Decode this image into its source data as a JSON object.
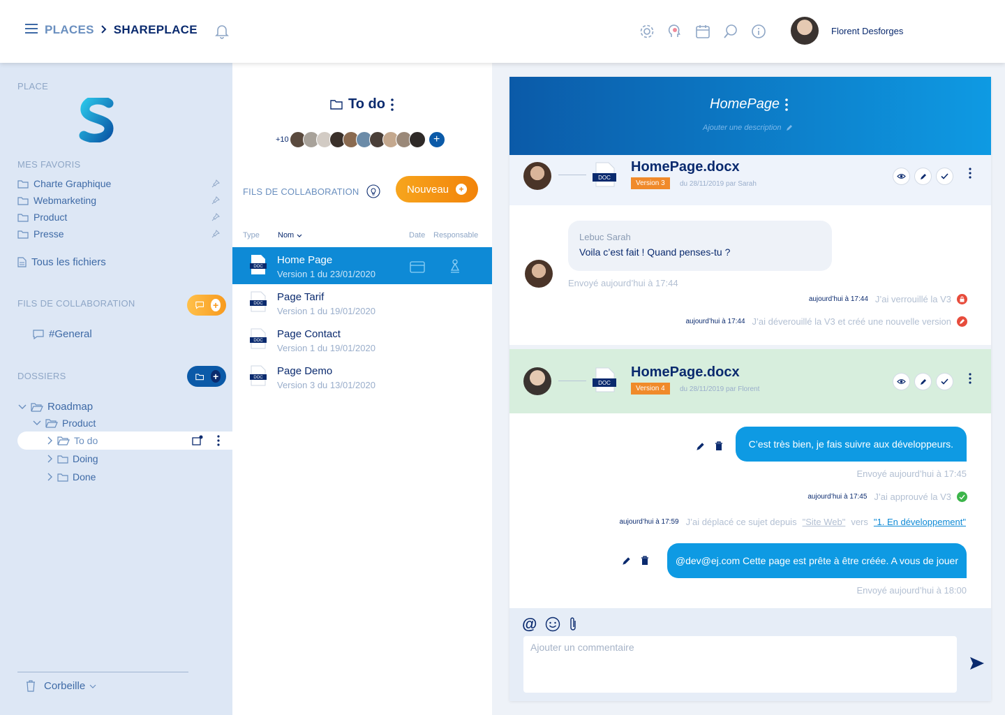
{
  "header": {
    "breadcrumb_root": "PLACES",
    "breadcrumb_current": "SHAREPLACE",
    "user_name": "Florent Desforges",
    "icons": [
      "menu-icon",
      "chevron-right-icon",
      "bell-icon",
      "gear-icon",
      "brain-icon",
      "calendar-icon",
      "search-icon",
      "info-icon"
    ]
  },
  "sidebar": {
    "place_title": "PLACE",
    "logo_letter": "S",
    "favorites_title": "MES FAVORIS",
    "favorites": [
      "Charte Graphique",
      "Webmarketing",
      "Product",
      "Presse"
    ],
    "all_files": "Tous les fichiers",
    "collab_title": "FILS DE COLLABORATION",
    "channel": "#General",
    "folders_title": "DOSSIERS",
    "tree": {
      "root": "Roadmap",
      "child": "Product",
      "items": [
        "To do",
        "Doing",
        "Done"
      ]
    },
    "trash": "Corbeille"
  },
  "middle": {
    "folder_name": "To do",
    "member_count": "+10",
    "collab_label": "FILS DE COLLABORATION",
    "new_button": "Nouveau",
    "columns": {
      "type": "Type",
      "name": "Nom",
      "date": "Date",
      "owner": "Responsable"
    },
    "files": [
      {
        "name": "Home Page",
        "version": "Version 1 du 23/01/2020"
      },
      {
        "name": "Page Tarif",
        "version": "Version 1 du 19/01/2020"
      },
      {
        "name": "Page Contact",
        "version": "Version 1 du 19/01/2020"
      },
      {
        "name": "Page Demo",
        "version": "Version 3 du 13/01/2020"
      }
    ],
    "doc_badge": "DOC"
  },
  "detail": {
    "title": "HomePage",
    "description_placeholder": "Ajouter une description",
    "versions": [
      {
        "file": "HomePage.docx",
        "tag": "Version 3",
        "meta": "du 28/11/2019 par Sarah",
        "color": "#eef3fb"
      },
      {
        "file": "HomePage.docx",
        "tag": "Version 4",
        "meta": "du 28/11/2019 par Florent",
        "color": "#d7eedd"
      }
    ],
    "incoming": {
      "author": "Lebuc Sarah",
      "text": "Voila c’est fait ! Quand penses-tu ?",
      "sent": "Envoyé aujourd’hui à 17:44"
    },
    "logs1": [
      {
        "time": "aujourd’hui à 17:44",
        "text": "J’ai verrouillé la V3",
        "status": "#e74c3c"
      },
      {
        "time": "aujourd’hui à 17:44",
        "text": "J’ai déverouillé la V3 et créé une nouvelle version",
        "status": "#e74c3c"
      }
    ],
    "outgoing1": {
      "text": "C’est très bien, je fais suivre aux développeurs.",
      "sent": "Envoyé aujourd’hui à 17:45"
    },
    "log_approve": {
      "time": "aujourd’hui à 17:45",
      "text": "J’ai approuvé la V3",
      "status": "#3cb54a"
    },
    "log_move": {
      "time": "aujourd’hui à 17:59",
      "text_a": "J’ai déplacé ce sujet depuis",
      "from": "\"Site Web\"",
      "text_b": "vers",
      "to": "\"1. En développement\""
    },
    "outgoing2": {
      "text": "@dev@ej.com Cette page est prête à être créée. A vous de jouer",
      "sent": "Envoyé aujourd’hui à 18:00"
    },
    "composer_placeholder": "Ajouter un commentaire"
  },
  "colors": {
    "primary": "#0a2a6e",
    "accent": "#0e9ae3",
    "orange": "#f2830a",
    "sidebar": "#dde7f5"
  }
}
